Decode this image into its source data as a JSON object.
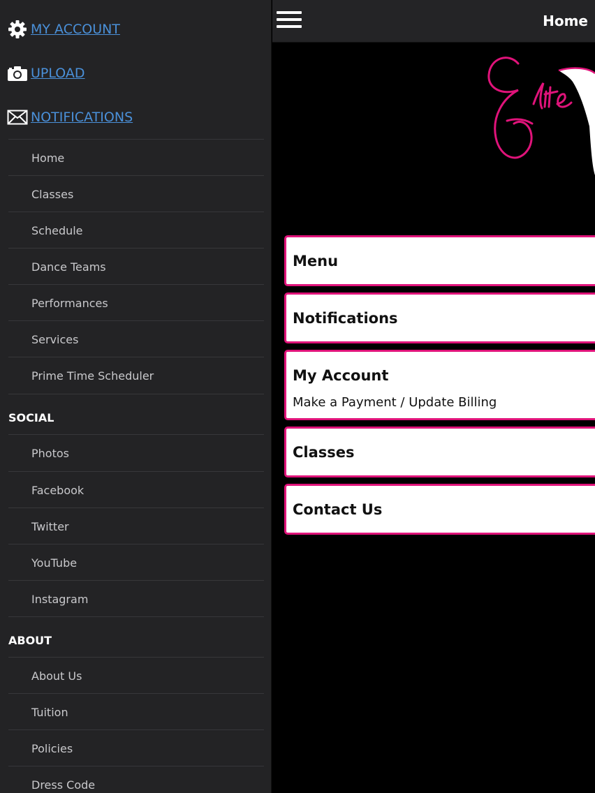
{
  "sidebar": {
    "top_links": [
      {
        "label": "MY ACCOUNT",
        "icon": "gear-icon"
      },
      {
        "label": "UPLOAD",
        "icon": "camera-icon"
      },
      {
        "label": "NOTIFICATIONS",
        "icon": "envelope-icon"
      }
    ],
    "main_items": [
      "Home",
      "Classes",
      "Schedule",
      "Dance Teams",
      "Performances",
      "Services",
      "Prime Time Scheduler"
    ],
    "social": {
      "heading": "SOCIAL",
      "items": [
        "Photos",
        "Facebook",
        "Twitter",
        "YouTube",
        "Instagram"
      ]
    },
    "about": {
      "heading": "ABOUT",
      "items": [
        "About Us",
        "Tuition",
        "Policies",
        "Dress Code"
      ]
    }
  },
  "header": {
    "title": "Home"
  },
  "cards": [
    {
      "title": "Menu"
    },
    {
      "title": "Notifications"
    },
    {
      "title": "My Account",
      "subtitle": "Make a Payment / Update Billing"
    },
    {
      "title": "Classes"
    },
    {
      "title": "Contact Us"
    }
  ],
  "colors": {
    "accent": "#e0137a",
    "link": "#4a90d9",
    "sidebar_bg": "#232325"
  }
}
